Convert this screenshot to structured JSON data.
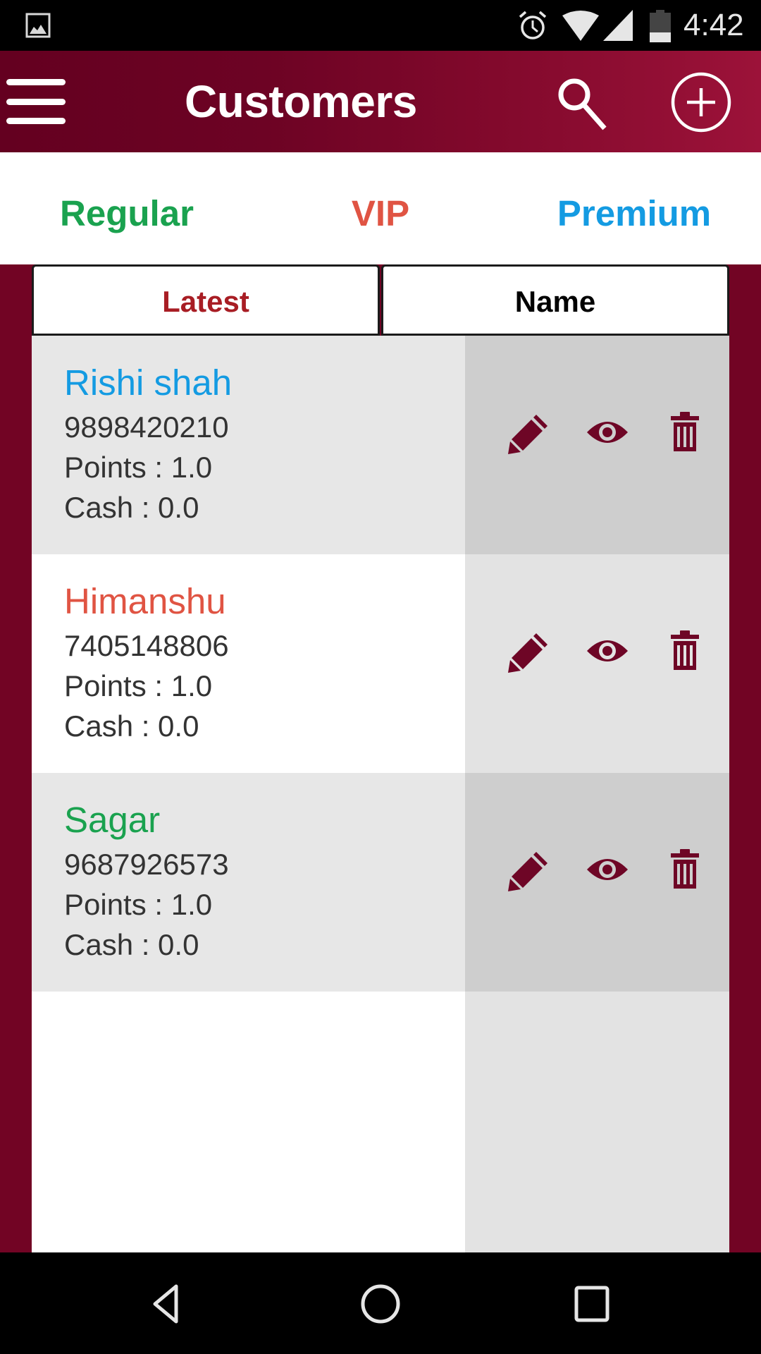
{
  "status_bar": {
    "time": "4:42",
    "icons": [
      "gallery-notification-icon",
      "alarm-icon",
      "wifi-icon",
      "cell-signal-icon",
      "battery-icon"
    ]
  },
  "header": {
    "title": "Customers",
    "menu_icon": "hamburger-menu-icon",
    "search_icon": "search-icon",
    "add_icon": "add-circle-icon"
  },
  "tabs": [
    {
      "label": "Regular",
      "color": "#1aa24f"
    },
    {
      "label": "VIP",
      "color": "#e05443"
    },
    {
      "label": "Premium",
      "color": "#149be2"
    }
  ],
  "sort": {
    "latest_label": "Latest",
    "name_label": "Name",
    "active": "Latest"
  },
  "customers": [
    {
      "name": "Rishi shah",
      "name_color": "#149be2",
      "phone": "9898420210",
      "points": "Points : 1.0",
      "cash": "Cash : 0.0"
    },
    {
      "name": "Himanshu",
      "name_color": "#e05443",
      "phone": "7405148806",
      "points": "Points : 1.0",
      "cash": "Cash : 0.0"
    },
    {
      "name": "Sagar",
      "name_color": "#1aa24f",
      "phone": "9687926573",
      "points": "Points : 1.0",
      "cash": "Cash : 0.0"
    }
  ],
  "row_actions": [
    "edit-pencil-icon",
    "view-eye-icon",
    "delete-trash-icon"
  ],
  "colors": {
    "brand_maroon": "#720424",
    "header_gradient_start": "#640020",
    "header_gradient_end": "#9c1239",
    "action_icon": "#6e0626"
  },
  "nav_bar": {
    "icons": [
      "back-icon",
      "home-icon",
      "recents-icon"
    ]
  }
}
